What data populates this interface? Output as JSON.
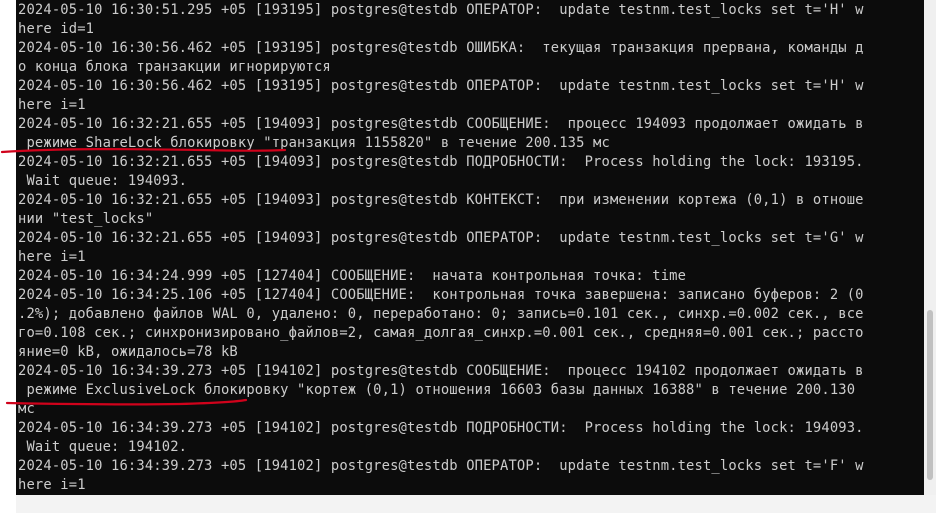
{
  "terminal": {
    "lines": [
      "2024-05-10 16:30:51.295 +05 [193195] postgres@testdb ОПЕРАТОР:  update testnm.test_locks set t='H' w",
      "here id=1",
      "2024-05-10 16:30:56.462 +05 [193195] postgres@testdb ОШИБКА:  текущая транзакция прервана, команды д",
      "о конца блока транзакции игнорируются",
      "2024-05-10 16:30:56.462 +05 [193195] postgres@testdb ОПЕРАТОР:  update testnm.test_locks set t='H' w",
      "here i=1",
      "2024-05-10 16:32:21.655 +05 [194093] postgres@testdb СООБЩЕНИЕ:  процесс 194093 продолжает ожидать в",
      " режиме ShareLock блокировку \"транзакция 1155820\" в течение 200.135 мс",
      "2024-05-10 16:32:21.655 +05 [194093] postgres@testdb ПОДРОБНОСТИ:  Process holding the lock: 193195.",
      " Wait queue: 194093.",
      "2024-05-10 16:32:21.655 +05 [194093] postgres@testdb КОНТЕКСТ:  при изменении кортежа (0,1) в отноше",
      "нии \"test_locks\"",
      "2024-05-10 16:32:21.655 +05 [194093] postgres@testdb ОПЕРАТОР:  update testnm.test_locks set t='G' w",
      "here i=1",
      "2024-05-10 16:34:24.999 +05 [127404] СООБЩЕНИЕ:  начата контрольная точка: time",
      "2024-05-10 16:34:25.106 +05 [127404] СООБЩЕНИЕ:  контрольная точка завершена: записано буферов: 2 (0",
      ".2%); добавлено файлов WAL 0, удалено: 0, переработано: 0; запись=0.101 сек., синхр.=0.002 сек., все",
      "го=0.108 сек.; синхронизировано_файлов=2, самая_долгая_синхр.=0.001 сек., средняя=0.001 сек.; рассто",
      "яние=0 kB, ожидалось=78 kB",
      "2024-05-10 16:34:39.273 +05 [194102] postgres@testdb СООБЩЕНИЕ:  процесс 194102 продолжает ожидать в",
      " режиме ExclusiveLock блокировку \"кортеж (0,1) отношения 16603 базы данных 16388\" в течение 200.130",
      "мс",
      "2024-05-10 16:34:39.273 +05 [194102] postgres@testdb ПОДРОБНОСТИ:  Process holding the lock: 194093.",
      " Wait queue: 194102.",
      "2024-05-10 16:34:39.273 +05 [194102] postgres@testdb ОПЕРАТОР:  update testnm.test_locks set t='F' w",
      "here i=1"
    ]
  },
  "colors": {
    "terminal_bg": "#0c0c0c",
    "terminal_text": "#cccccc",
    "annotation_stroke": "#d0021b"
  }
}
